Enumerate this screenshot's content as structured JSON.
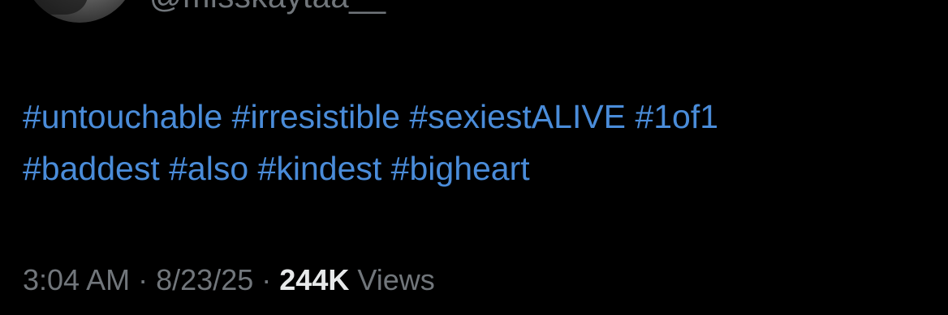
{
  "author": {
    "handle": "@misskaytaa__"
  },
  "tweet": {
    "lines": [
      [
        "#untouchable",
        "#irresistible",
        "#sexiestALIVE",
        "#1of1"
      ],
      [
        "#baddest",
        "#also",
        "#kindest",
        "#bigheart"
      ]
    ]
  },
  "meta": {
    "time": "3:04 AM",
    "separator": "·",
    "date": "8/23/25",
    "views_count": "244K",
    "views_label": "Views"
  },
  "colors": {
    "background": "#000000",
    "hashtag": "#4a8cd9",
    "secondary_text": "#71767b",
    "primary_text": "#e7e9ea"
  }
}
